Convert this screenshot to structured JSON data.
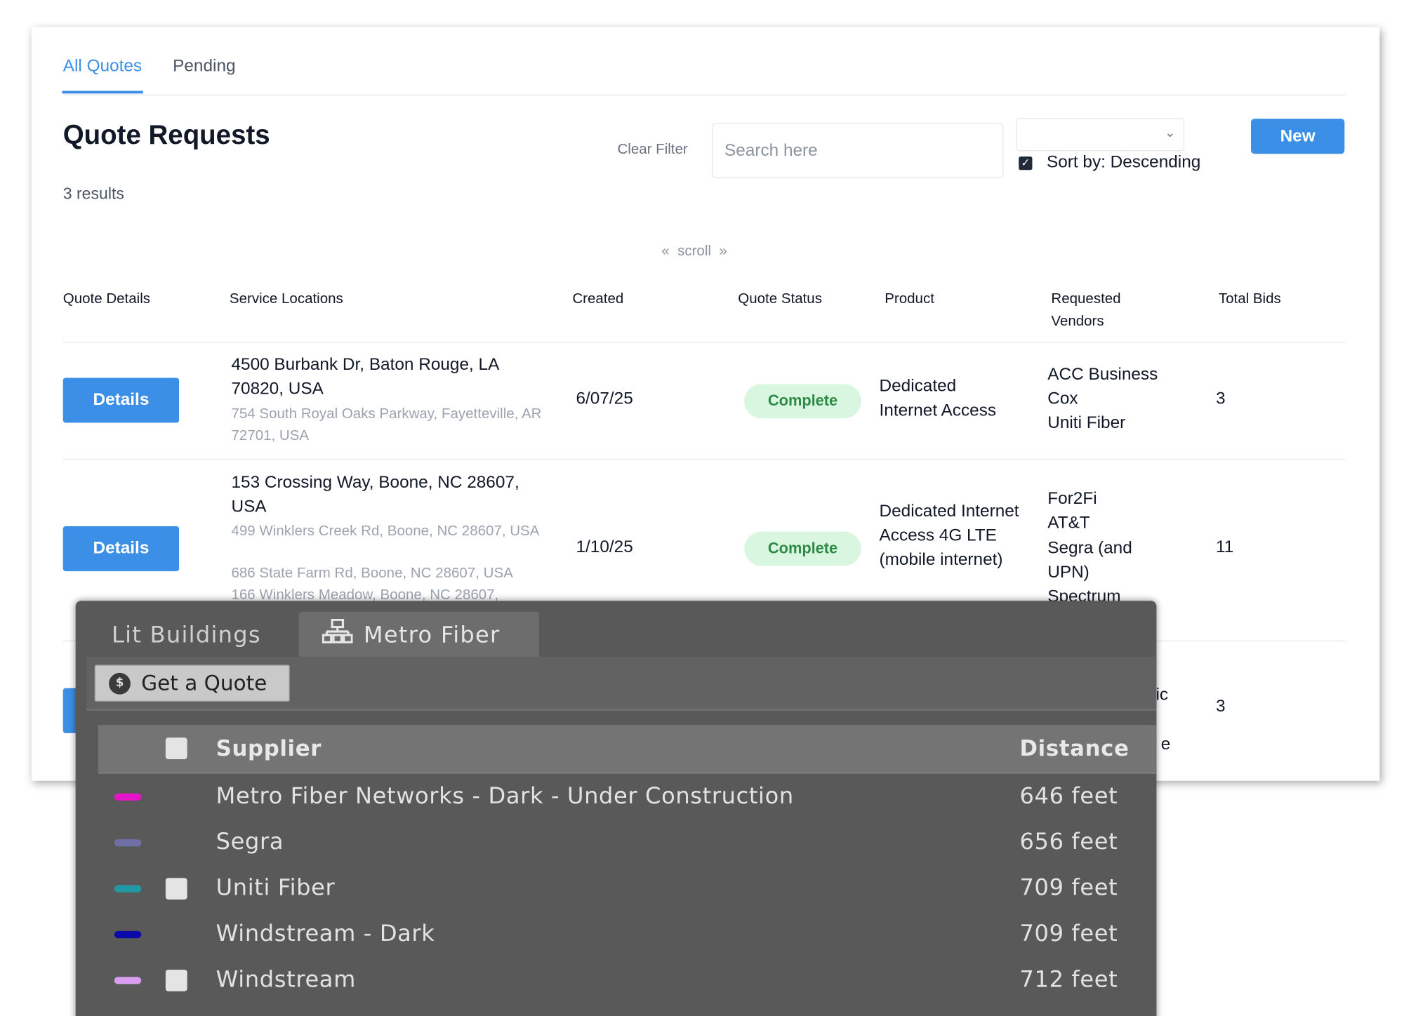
{
  "tabs": [
    {
      "label": "All Quotes",
      "active": true
    },
    {
      "label": "Pending",
      "active": false
    }
  ],
  "header": {
    "title": "Quote Requests",
    "results": "3 results",
    "clear_filter": "Clear Filter",
    "search_placeholder": "Search here",
    "sort_checked": true,
    "sort_label": "Sort by: Descending",
    "new_label": "New",
    "scroll_label": "scroll",
    "scroll_left": "«",
    "scroll_right": "»"
  },
  "table": {
    "columns": [
      "Quote Details",
      "Service Locations",
      "Created",
      "Quote Status",
      "Product",
      "Requested Vendors",
      "Total Bids"
    ],
    "details_label": "Details",
    "rows": [
      {
        "primary_location": "4500 Burbank Dr, Baton Rouge, LA 70820, USA",
        "other_locations": [
          "754 South Royal Oaks Parkway, Fayetteville, AR 72701, USA"
        ],
        "created": "6/07/25",
        "status": "Complete",
        "product": "Dedicated Internet Access",
        "vendors": [
          "ACC Business",
          "Cox",
          "Uniti Fiber"
        ],
        "total_bids": "3"
      },
      {
        "primary_location": "153 Crossing Way, Boone, NC 28607, USA",
        "other_locations": [
          "499 Winklers Creek Rd, Boone, NC 28607, USA",
          "686 State Farm Rd, Boone, NC 28607, USA",
          "166 Winklers Meadow, Boone, NC 28607,"
        ],
        "created": "1/10/25",
        "status": "Complete",
        "product": "Dedicated Internet Access 4G LTE (mobile internet)",
        "vendors": [
          "For2Fi",
          "AT&T",
          "Segra (and UPN)",
          "Spectrum"
        ],
        "total_bids": "11"
      },
      {
        "vendors_visible": "ric",
        "vendors_visible_2": "e",
        "total_bids": "3"
      }
    ]
  },
  "panel": {
    "tabs": [
      {
        "label": "Lit Buildings",
        "active": false
      },
      {
        "label": "Metro Fiber",
        "icon": "network-icon",
        "active": true
      }
    ],
    "get_quote_label": "Get a Quote",
    "get_quote_icon": "$",
    "columns": {
      "supplier": "Supplier",
      "distance": "Distance"
    },
    "rows": [
      {
        "name": "Metro Fiber Networks - Dark - Under Construction",
        "distance": "646 feet",
        "color": "#e614c8",
        "checkbox": false
      },
      {
        "name": "Segra",
        "distance": "656 feet",
        "color": "#6f6fa5",
        "checkbox": false
      },
      {
        "name": "Uniti Fiber",
        "distance": "709 feet",
        "color": "#1f9aa5",
        "checkbox": true
      },
      {
        "name": "Windstream - Dark",
        "distance": "709 feet",
        "color": "#0a0aa8",
        "checkbox": false
      },
      {
        "name": "Windstream",
        "distance": "712 feet",
        "color": "#d99ef0",
        "checkbox": true
      }
    ]
  },
  "colors": {
    "accent": "#3b8fe6",
    "complete_bg": "#d9f7e0",
    "complete_text": "#2f8a45",
    "panel_bg": "#595959"
  }
}
